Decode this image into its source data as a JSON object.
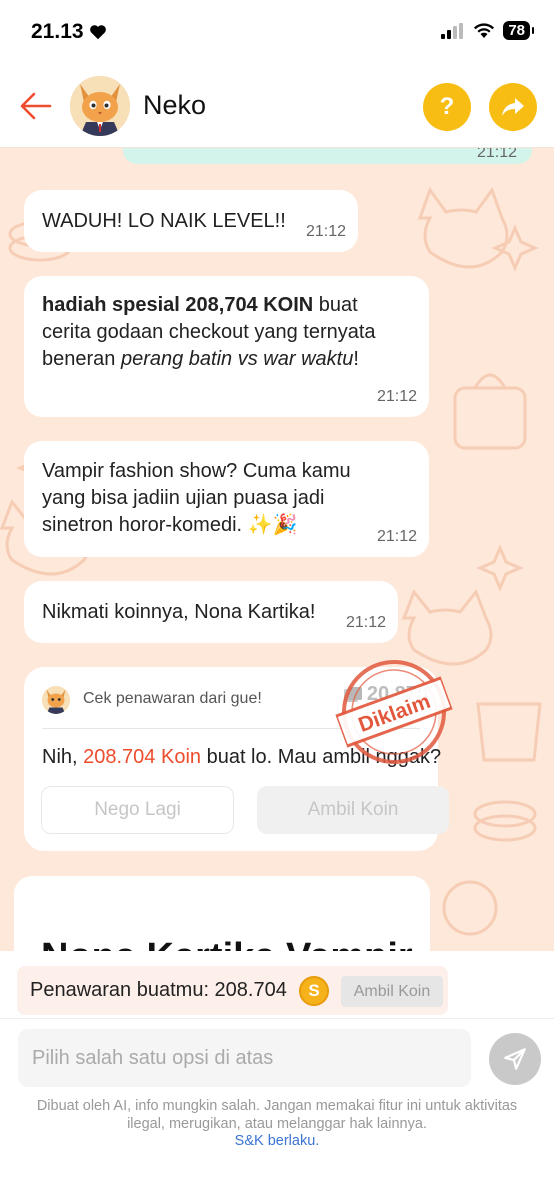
{
  "status_bar": {
    "time": "21.13",
    "battery": "78"
  },
  "header": {
    "chat_name": "Neko",
    "help_label": "?"
  },
  "messages": [
    {
      "text": "WADUH! LO NAIK LEVEL!!",
      "time": "21:12"
    },
    {
      "bold": "hadiah spesial 208,704 KOIN",
      "text_a": " buat cerita godaan checkout yang ternyata beneran ",
      "italic": "perang batin vs war waktu",
      "text_b": "!",
      "time": "21:12"
    },
    {
      "text": "Vampir fashion show? Cuma kamu yang bisa jadiin ujian puasa jadi sinetron horor-komedi. ✨🎉",
      "time": "21:12"
    },
    {
      "text": "Nikmati koinnya, Nona Kartika!",
      "time": "21:12"
    }
  ],
  "top_bubble_time": "21:12",
  "offer_card": {
    "title": "Cek penawaran dari gue!",
    "coin_count": "20,870",
    "text_prefix": "Nih, ",
    "amount": "208.704 Koin",
    "text_suffix": " buat lo. Mau ambil nggak?",
    "nego_label": "Nego Lagi",
    "ambil_label": "Ambil Koin",
    "stamp": "Diklaim"
  },
  "big_message": {
    "title": "Nona Kartika Vampir"
  },
  "offer_bar": {
    "label": "Penawaran buatmu: 208.704",
    "coin_symbol": "S",
    "button": "Ambil Koin"
  },
  "input": {
    "placeholder": "Pilih salah satu opsi di atas"
  },
  "footer": {
    "disclaimer": "Dibuat oleh AI, info mungkin salah. Jangan memakai fitur ini untuk aktivitas ilegal, merugikan, atau melanggar hak lainnya.",
    "terms": "S&K berlaku."
  },
  "colors": {
    "accent": "#ee4d2d",
    "yellow": "#f8bd12",
    "chat_bg": "#fde8da",
    "mint": "#d2f4ea"
  }
}
